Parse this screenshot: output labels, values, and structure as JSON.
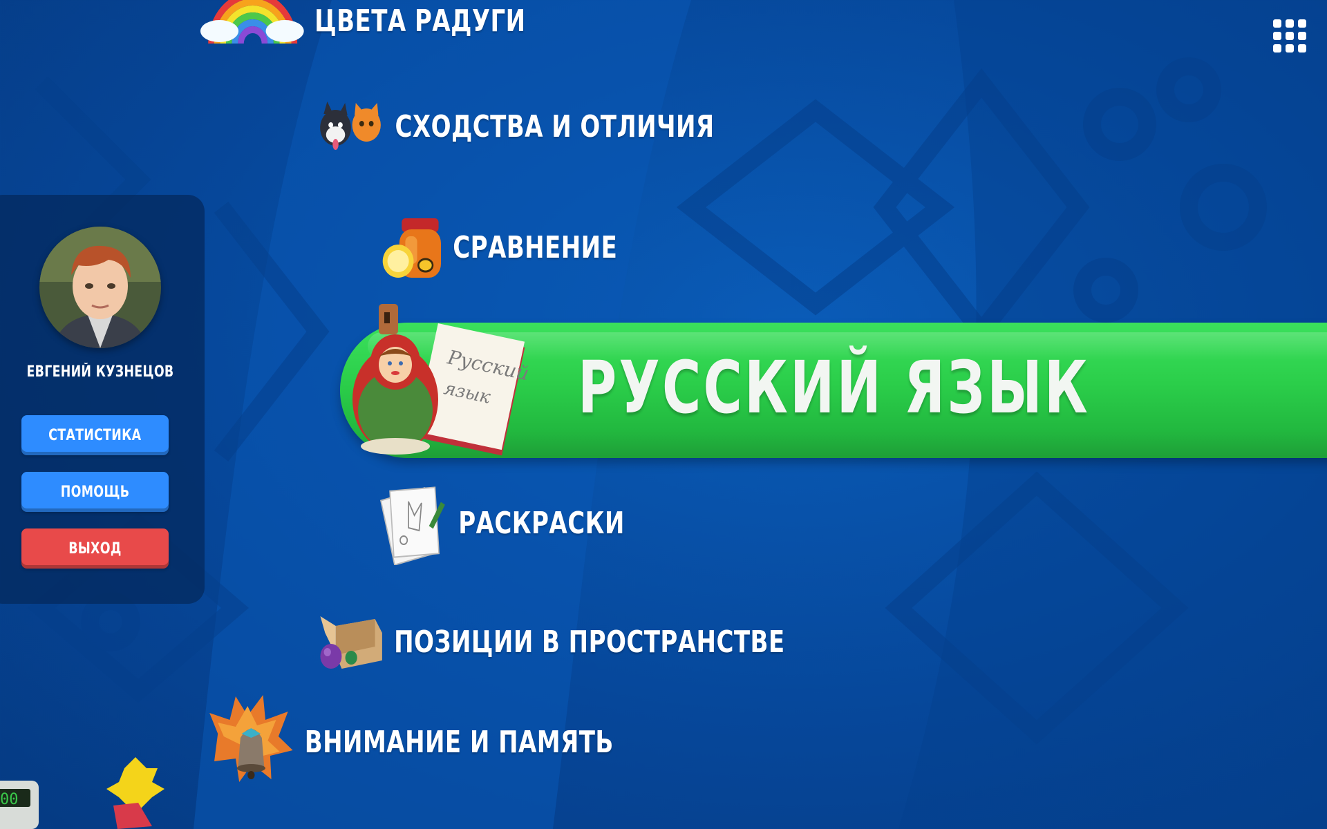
{
  "menu": {
    "items": [
      {
        "label": "ЦВЕТА РАДУГИ",
        "icon": "rainbow-icon"
      },
      {
        "label": "СХОДСТВА И ОТЛИЧИЯ",
        "icon": "dog-cat-icon"
      },
      {
        "label": "СРАВНЕНИЕ",
        "icon": "honey-jar-icon"
      },
      {
        "label": "РАСКРАСКИ",
        "icon": "coloring-pages-icon"
      },
      {
        "label": "ПОЗИЦИИ В ПРОСТРАНСТВЕ",
        "icon": "box-balls-icon"
      },
      {
        "label": "ВНИМАНИЕ И ПАМЯТЬ",
        "icon": "bell-icon"
      }
    ],
    "selected": {
      "label": "РУССКИЙ ЯЗЫК",
      "icon": "matryoshka-book-icon"
    }
  },
  "user": {
    "name": "ЕВГЕНИЙ КУЗНЕЦОВ"
  },
  "buttons": {
    "stats": "СТАТИСТИКА",
    "help": "ПОМОЩЬ",
    "exit": "ВЫХОД"
  },
  "colors": {
    "background": "#06479a",
    "selected_bar": "#2bce4a",
    "button_blue": "#2e8cff",
    "button_red": "#e84a4a"
  },
  "apps_icon": "grid-apps-icon"
}
